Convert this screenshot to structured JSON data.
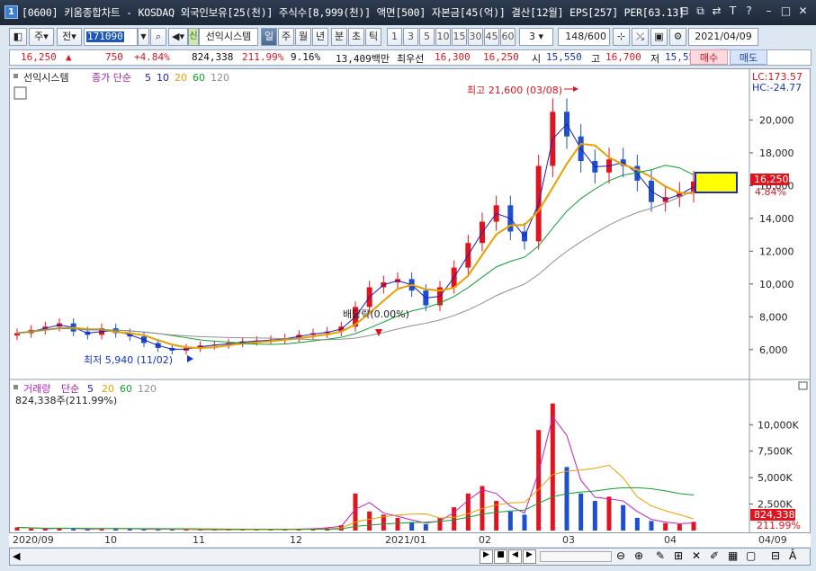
{
  "window": {
    "num_icon": "1",
    "title": "[0600] 키움종합차트 - KOSDAQ 외국인보유[25(천)] 주식수[8,999(천)] 액면[500] 자본금[45(억)] 결산[12월] EPS[257] PER[63.13]",
    "buttons": [
      "restore-icon",
      "copy-icon",
      "link-icon",
      "text-icon",
      "help-icon",
      "minimize-icon",
      "maximize-icon",
      "close-icon"
    ]
  },
  "toolbar": {
    "period_label": "주",
    "prev_label": "전",
    "stock_code": "171090",
    "system_tag": "신",
    "system_label": "선익시스템",
    "tabs": [
      "일",
      "주",
      "월",
      "년",
      "분",
      "초",
      "틱"
    ],
    "active_tab": "일",
    "intervals": [
      "1",
      "3",
      "5",
      "10",
      "15",
      "30",
      "45",
      "60"
    ],
    "interval_select": "3",
    "count": "148",
    "count_total": "/600",
    "date": "2021/04/09"
  },
  "quote": {
    "price": "16,250",
    "arrow": "▲",
    "change": "750",
    "change_pct": "+4.84%",
    "volume": "824,338",
    "volume_ratio": "211.99%",
    "turnover": "9.16%",
    "amount": "13,409백만",
    "best_ask_label": "최우선",
    "best_ask": "16,300",
    "best_bid": "16,250",
    "open_label": "시",
    "open": "15,550",
    "high_label": "고",
    "high": "16,700",
    "low_label": "저",
    "low": "15,550",
    "buy_label": "매수",
    "sell_label": "매도"
  },
  "price_panel": {
    "name_label": "선익시스템",
    "ma_label": "종가 단순",
    "ma_periods": [
      "5",
      "10",
      "20",
      "60",
      "120"
    ],
    "ma_colors": [
      "#1d1db8",
      "#e8a000",
      "#10a030",
      "#909090",
      "#a040a0"
    ],
    "lc_label": "LC:173.57",
    "hc_label": "HC:-24.77",
    "y_ticks": [
      "20,000",
      "18,000",
      "16,000",
      "14,000",
      "12,000",
      "10,000",
      "8,000",
      "6,000"
    ],
    "current_price": "16,250",
    "current_pct": "4.84%",
    "high_annotation": "최고 21,600 (03/08)",
    "low_annotation": "최저 5,940 (11/02)",
    "dividend_annotation": "배당락(0.00%)"
  },
  "volume_panel": {
    "title": "거래량",
    "ma_label": "단순",
    "ma_periods": [
      "5",
      "20",
      "60",
      "120"
    ],
    "current": "824,338주(211.99%)",
    "y_ticks": [
      "10,000K",
      "7,500K",
      "5,000K",
      "2,500K"
    ],
    "current_value": "824,338",
    "current_pct": "211.99%"
  },
  "x_axis": [
    "2020/09",
    "10",
    "11",
    "12",
    "2021/01",
    "02",
    "03",
    "04",
    "04/09"
  ],
  "chart_data": {
    "type": "candlestick",
    "x_range": [
      "2020/09",
      "2021/04/09"
    ],
    "ylim": [
      5000,
      22000
    ],
    "high": {
      "value": 21600,
      "date": "03/08"
    },
    "low": {
      "value": 5940,
      "date": "11/02"
    },
    "last_close": 16250,
    "series": [
      {
        "name": "종가",
        "values": [
          7000,
          7200,
          7400,
          7600,
          7100,
          6900,
          7300,
          7000,
          6800,
          6400,
          6100,
          5940,
          6100,
          6250,
          6300,
          6400,
          6500,
          6550,
          6600,
          6700,
          6900,
          7000,
          7100,
          7400,
          8600,
          9800,
          10100,
          10300,
          9600,
          8700,
          9800,
          11000,
          12500,
          13800,
          14800,
          13200,
          12600,
          17200,
          20500,
          19000,
          17500,
          16800,
          17600,
          17200,
          16300,
          15000,
          15300,
          15600,
          16250
        ]
      }
    ],
    "volume_k": [
      300,
      200,
      150,
      250,
      150,
      120,
      200,
      180,
      160,
      120,
      110,
      150,
      90,
      80,
      70,
      80,
      90,
      100,
      110,
      120,
      150,
      200,
      300,
      500,
      3500,
      1800,
      1500,
      1200,
      800,
      600,
      1200,
      2200,
      3500,
      4200,
      2800,
      1800,
      1500,
      9500,
      12000,
      6000,
      3500,
      2800,
      3200,
      2400,
      1200,
      900,
      700,
      600,
      824
    ]
  }
}
